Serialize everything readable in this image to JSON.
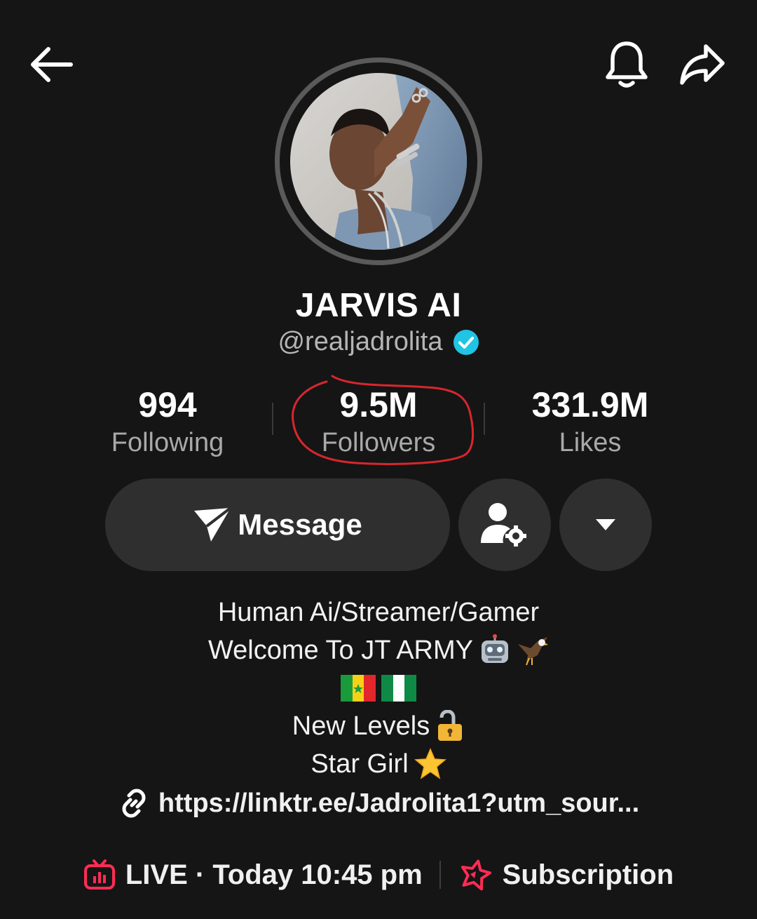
{
  "header": {
    "back_icon": "arrow-left-icon",
    "notification_icon": "bell-icon",
    "share_icon": "share-arrow-icon"
  },
  "profile": {
    "display_name": "JARVIS AI",
    "handle": "@realjadrolita",
    "verified": true,
    "verified_color": "#20C4E4",
    "avatar_ring_color": "#5A5A5A"
  },
  "stats": {
    "following": {
      "value": "994",
      "label": "Following"
    },
    "followers": {
      "value": "9.5M",
      "label": "Followers"
    },
    "likes": {
      "value": "331.9M",
      "label": "Likes"
    },
    "annotation_color": "#D8262E"
  },
  "actions": {
    "message_label": "Message",
    "message_icon": "paper-plane-icon",
    "follow_settings_icon": "user-gear-icon",
    "more_icon": "caret-down-icon"
  },
  "bio": {
    "line1": "Human Ai/Streamer/Gamer",
    "line2": "Welcome To JT ARMY",
    "line2_emojis": [
      "robot-emoji",
      "eagle-emoji"
    ],
    "line3_emojis": [
      "senegal-flag-emoji",
      "nigeria-flag-emoji"
    ],
    "line4": "New Levels",
    "line4_emoji": "unlocked-padlock-emoji",
    "line5": "Star Girl",
    "line5_emoji": "star-emoji"
  },
  "link": {
    "icon": "link-icon",
    "text": "https://linktr.ee/Jadrolita1?utm_sour..."
  },
  "bottom": {
    "live_icon": "tv-live-icon",
    "live_text": "LIVE · Today 10:45 pm",
    "subscription_icon": "star-badge-icon",
    "subscription_text": "Subscription",
    "accent_color": "#FE2C55"
  }
}
